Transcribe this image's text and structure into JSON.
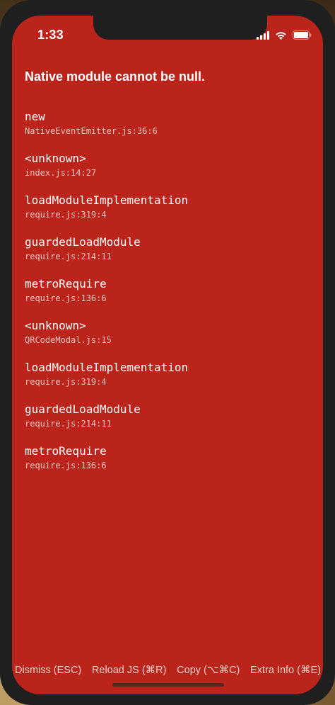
{
  "status_bar": {
    "time": "1:33",
    "icons": [
      "signal-icon",
      "wifi-icon",
      "battery-icon"
    ]
  },
  "error": {
    "title": "Native module cannot be null."
  },
  "stack": [
    {
      "method": "new",
      "file": "NativeEventEmitter.js:36:6"
    },
    {
      "method": "<unknown>",
      "file": "index.js:14:27"
    },
    {
      "method": "loadModuleImplementation",
      "file": "require.js:319:4"
    },
    {
      "method": "guardedLoadModule",
      "file": "require.js:214:11"
    },
    {
      "method": "metroRequire",
      "file": "require.js:136:6"
    },
    {
      "method": "<unknown>",
      "file": "QRCodeModal.js:15"
    },
    {
      "method": "loadModuleImplementation",
      "file": "require.js:319:4"
    },
    {
      "method": "guardedLoadModule",
      "file": "require.js:214:11"
    },
    {
      "method": "metroRequire",
      "file": "require.js:136:6"
    }
  ],
  "actions": {
    "dismiss": "Dismiss (ESC)",
    "reload": "Reload JS (⌘R)",
    "copy": "Copy (⌥⌘C)",
    "extra_info": "Extra Info (⌘E)"
  },
  "colors": {
    "background": "#bb241b",
    "text": "#ffffff",
    "secondary_text": "#f2c4c0"
  }
}
